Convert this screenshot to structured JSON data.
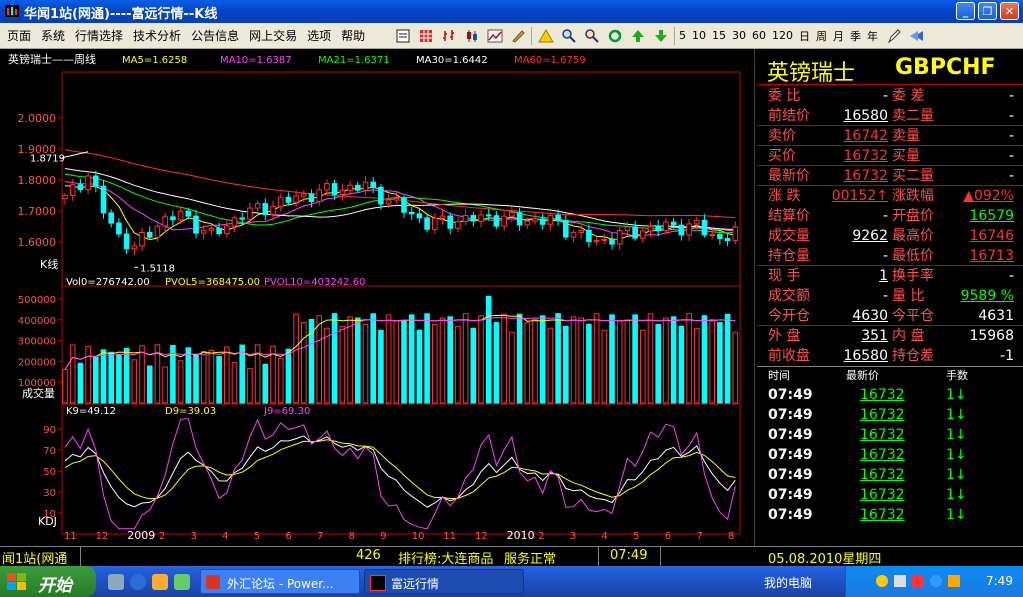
{
  "window": {
    "title": "华闻1站(网通)----富远行情--K线",
    "buttons": [
      "_",
      "❐",
      "✕"
    ]
  },
  "menu": [
    "页面",
    "系统",
    "行情选择",
    "技术分析",
    "公告信息",
    "网上交易",
    "选项",
    "帮助"
  ],
  "toolbar": {
    "icon_buttons": [
      "note-icon",
      "grid-icon",
      "bar-icon",
      "candle-icon",
      "trend-icon",
      "draw-icon",
      "alert-icon",
      "search-icon",
      "search2-icon",
      "refresh-icon",
      "up-icon",
      "down-icon"
    ],
    "periods": [
      "5",
      "10",
      "15",
      "30",
      "60",
      "120",
      "日",
      "周",
      "月",
      "季",
      "年"
    ]
  },
  "chart": {
    "name": "英镑瑞士——周线",
    "ma_legend": [
      {
        "text": "MA5=1.6258",
        "color": "#ffff00"
      },
      {
        "text": "MA10=1.6387",
        "color": "#ff40ff"
      },
      {
        "text": "MA21=1.6371",
        "color": "#00ff00"
      },
      {
        "text": "MA30=1.6442",
        "color": "#ffffff"
      },
      {
        "text": "MA60=1.6759",
        "color": "#ff3030"
      }
    ],
    "price_ticks": [
      "2.0000",
      "1.9000",
      "1.8000",
      "1.7000",
      "1.6000"
    ],
    "high_mark": "1.8719",
    "low_mark": "1.5118",
    "kline_label": "K线",
    "vol_legend": [
      {
        "text": "Vol0=276742.00",
        "color": "#ffffff"
      },
      {
        "text": "PVOL5=368475.00",
        "color": "#ffff00"
      },
      {
        "text": "PVOL10=403242.60",
        "color": "#ff40ff"
      }
    ],
    "vol_ticks": [
      "500000",
      "400000",
      "300000",
      "200000",
      "100000"
    ],
    "vol_label": "成交量",
    "kdj_legend": [
      {
        "text": "K9=49.12",
        "color": "#ffffff"
      },
      {
        "text": "D9=39.03",
        "color": "#ffff00"
      },
      {
        "text": "J9=69.30",
        "color": "#ff40ff"
      }
    ],
    "kdj_ticks": [
      "90",
      "70",
      "50",
      "30",
      "10"
    ],
    "kdj_label": "KDJ",
    "x_labels": [
      "11",
      "12",
      "2009",
      "2",
      "3",
      "4",
      "5",
      "6",
      "7",
      "8",
      "9",
      "10",
      "11",
      "12",
      "2010",
      "2",
      "3",
      "4",
      "5",
      "6",
      "7",
      "8"
    ],
    "colors": {
      "up": "#ff3030",
      "down": "#00ffff",
      "axis": "#c00000",
      "text_red": "#ff5050"
    }
  },
  "quote": {
    "name": "英镑瑞士",
    "code": "GBPCHF",
    "rows": [
      {
        "l1": "委  比",
        "v1": "-",
        "v1c": "#ffffff",
        "l2": "委  差",
        "v2": "-",
        "v2c": "#ffffff"
      },
      {
        "l1": "前结价",
        "v1": "16580",
        "v1c": "#ffffff",
        "l2": "卖二量",
        "v2": "-",
        "v2c": "#ffffff"
      },
      {
        "l1": "卖价",
        "v1": "16742",
        "v1c": "#ff3030",
        "l2": "卖量",
        "v2": "-",
        "v2c": "#ffffff"
      },
      {
        "l1": "买价",
        "v1": "16732",
        "v1c": "#ff3030",
        "l2": "买量",
        "v2": "-",
        "v2c": "#ffffff"
      },
      {
        "l1": "最新价",
        "v1": "16732",
        "v1c": "#ff3030",
        "l2": "买二量",
        "v2": "-",
        "v2c": "#ffffff"
      },
      {
        "l1": "涨  跌",
        "v1": "00152↑",
        "v1c": "#ff3030",
        "l2": "涨跌幅",
        "v2": "▲092%",
        "v2c": "#ff3030"
      },
      {
        "l1": "结算价",
        "v1": "-",
        "v1c": "#ffffff",
        "l2": "开盘价",
        "v2": "16579",
        "v2c": "#00ff00"
      },
      {
        "l1": "成交量",
        "v1": "9262",
        "v1c": "#ffffff",
        "l2": "最高价",
        "v2": "16746",
        "v2c": "#ff3030"
      },
      {
        "l1": "持仓量",
        "v1": "-",
        "v1c": "#ffffff",
        "l2": "最低价",
        "v2": "16713",
        "v2c": "#ff3030"
      },
      {
        "l1": "现  手",
        "v1": "1",
        "v1c": "#ffffff",
        "l2": "换手率",
        "v2": "-",
        "v2c": "#ffffff"
      },
      {
        "l1": "成交额",
        "v1": "-",
        "v1c": "#ffffff",
        "l2": "量  比",
        "v2": "9589 %",
        "v2c": "#00ff00"
      },
      {
        "l1": "今开仓",
        "v1": "4630",
        "v1c": "#ffffff",
        "l2": "今平仓",
        "v2": "4631",
        "v2c": "#ffffff"
      },
      {
        "l1": "外  盘",
        "v1": "351",
        "v1c": "#ffffff",
        "l2": "内  盘",
        "v2": "15968",
        "v2c": "#ffffff"
      },
      {
        "l1": "前收盘",
        "v1": "16580",
        "v1c": "#ffffff",
        "l2": "持仓差",
        "v2": "-1",
        "v2c": "#ffffff"
      }
    ],
    "trade_headers": [
      "时间",
      "最新价",
      "手数"
    ],
    "trades": [
      {
        "time": "07:49",
        "price": "16732",
        "qty": "1↓"
      },
      {
        "time": "07:49",
        "price": "16732",
        "qty": "1↓"
      },
      {
        "time": "07:49",
        "price": "16732",
        "qty": "1↓"
      },
      {
        "time": "07:49",
        "price": "16732",
        "qty": "1↓"
      },
      {
        "time": "07:49",
        "price": "16732",
        "qty": "1↓"
      },
      {
        "time": "07:49",
        "price": "16732",
        "qty": "1↓"
      },
      {
        "time": "07:49",
        "price": "16732",
        "qty": "1↓"
      }
    ]
  },
  "status": {
    "server": "闻1站(网通",
    "count": "426",
    "ranking": "排行榜:大连商品",
    "service": "服务正常",
    "time": "07:49",
    "date": "05.08.2010星期四"
  },
  "taskbar": {
    "start": "开始",
    "tasks": [
      "外汇论坛 - Power...",
      "富远行情"
    ],
    "computer": "我的电脑",
    "clock": "7:49"
  }
}
